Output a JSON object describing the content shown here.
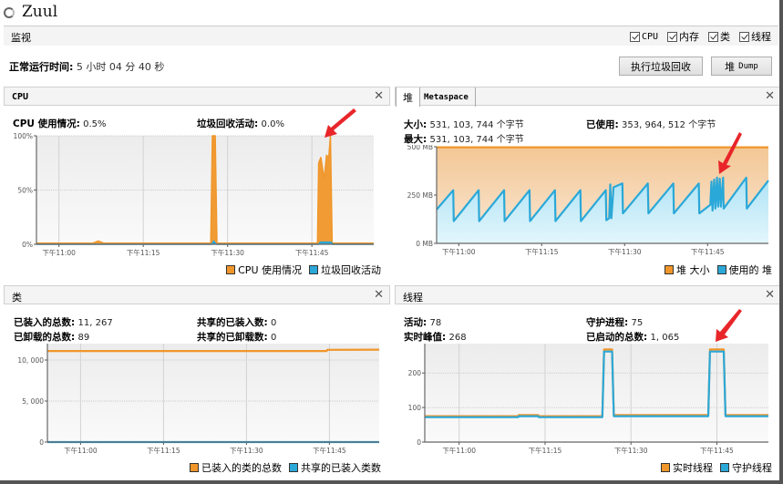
{
  "window": {
    "title": "Zuul"
  },
  "monitor": {
    "label": "监视",
    "checks": [
      {
        "label": "CPU",
        "checked": true
      },
      {
        "label": "内存",
        "checked": true
      },
      {
        "label": "类",
        "checked": true
      },
      {
        "label": "线程",
        "checked": true
      }
    ],
    "uptime_label": "正常运行时间:",
    "uptime_value": "5 小时 04 分 40 秒",
    "gc_button": "执行垃圾回收",
    "dump_button_prefix": "堆",
    "dump_button_suffix": "Dump"
  },
  "colors": {
    "orange": "#f0962a",
    "blue": "#2aa8d8",
    "arrow": "#e8262a"
  },
  "time_ticks": [
    "下午11:00",
    "下午11:15",
    "下午11:30",
    "下午11:45"
  ],
  "cpu": {
    "title": "CPU",
    "usage_label": "CPU 使用情况:",
    "usage_value": "0.5%",
    "gc_label": "垃圾回收活动:",
    "gc_value": "0.0%",
    "legend": [
      "CPU 使用情况",
      "垃圾回收活动"
    ]
  },
  "heap": {
    "tabs": [
      "堆",
      "Metaspace"
    ],
    "size_label": "大小:",
    "size_value": "531, 103, 744 个字节",
    "used_label": "已使用:",
    "used_value": "353, 964, 512 个字节",
    "max_label": "最大:",
    "max_value": "531, 103, 744 个字节",
    "legend": [
      "堆 大小",
      "使用的 堆"
    ]
  },
  "classes": {
    "title": "类",
    "loaded_label": "已装入的总数:",
    "loaded_value": "11, 267",
    "unloaded_label": "已卸载的总数:",
    "unloaded_value": "89",
    "shared_loaded_label": "共享的已装入数:",
    "shared_loaded_value": "0",
    "shared_unloaded_label": "共享的已卸载数:",
    "shared_unloaded_value": "0",
    "legend": [
      "已装入的类的总数",
      "共享的已装入类数"
    ]
  },
  "threads": {
    "title": "线程",
    "live_label": "活动:",
    "live_value": "78",
    "peak_label": "实时峰值:",
    "peak_value": "268",
    "daemon_label": "守护进程:",
    "daemon_value": "75",
    "started_label": "已启动的总数:",
    "started_value": "1, 065",
    "legend": [
      "实时线程",
      "守护线程"
    ]
  },
  "chart_data": [
    {
      "id": "cpu",
      "type": "area",
      "title": "CPU",
      "x_unit": "minutes since 10:56 PM",
      "xlim": [
        0,
        60
      ],
      "x_ticks": [
        4,
        19,
        34,
        49
      ],
      "x_tick_labels": [
        "下午11:00",
        "下午11:15",
        "下午11:30",
        "下午11:45"
      ],
      "ylim": [
        0,
        100
      ],
      "y_ticks": [
        0,
        50,
        100
      ],
      "y_tick_labels": [
        "0%",
        "50%",
        "100%"
      ],
      "series": [
        {
          "name": "CPU 使用情况",
          "color": "#f0962a",
          "points": [
            [
              0,
              1
            ],
            [
              10,
              1
            ],
            [
              11,
              3
            ],
            [
              12,
              1
            ],
            [
              31,
              1
            ],
            [
              31.3,
              100
            ],
            [
              31.8,
              100
            ],
            [
              32.1,
              1
            ],
            [
              50,
              1
            ],
            [
              50.2,
              75
            ],
            [
              50.6,
              80
            ],
            [
              51.2,
              60
            ],
            [
              51.6,
              82
            ],
            [
              52,
              80
            ],
            [
              52.3,
              100
            ],
            [
              52.6,
              1
            ],
            [
              60,
              1
            ]
          ]
        },
        {
          "name": "垃圾回收活动",
          "color": "#2aa8d8",
          "points": [
            [
              0,
              0
            ],
            [
              31.2,
              0
            ],
            [
              31.5,
              3
            ],
            [
              32,
              0
            ],
            [
              50.2,
              0
            ],
            [
              50.5,
              2
            ],
            [
              52.4,
              2
            ],
            [
              52.7,
              0
            ],
            [
              60,
              0
            ]
          ]
        }
      ],
      "legend_position": "bottom-right"
    },
    {
      "id": "heap",
      "type": "area",
      "title": "堆",
      "xlim": [
        0,
        60
      ],
      "x_ticks": [
        4,
        19,
        34,
        49
      ],
      "x_tick_labels": [
        "下午11:00",
        "下午11:15",
        "下午11:30",
        "下午11:45"
      ],
      "ylim": [
        0,
        500
      ],
      "y_ticks": [
        0,
        250,
        500
      ],
      "y_tick_labels": [
        "0 MB",
        "250 MB",
        "500 MB"
      ],
      "series": [
        {
          "name": "堆 大小",
          "color": "#f0962a",
          "points": [
            [
              0,
              497
            ],
            [
              60,
              497
            ]
          ]
        },
        {
          "name": "使用的 堆",
          "color": "#2aa8d8",
          "points": [
            [
              0,
              175
            ],
            [
              3,
              275
            ],
            [
              3.1,
              115
            ],
            [
              7.6,
              275
            ],
            [
              7.7,
              115
            ],
            [
              12.2,
              275
            ],
            [
              12.3,
              115
            ],
            [
              16.8,
              275
            ],
            [
              16.9,
              115
            ],
            [
              21.4,
              275
            ],
            [
              21.5,
              115
            ],
            [
              26,
              275
            ],
            [
              26.1,
              115
            ],
            [
              30.6,
              275
            ],
            [
              30.7,
              120
            ],
            [
              31.2,
              130
            ],
            [
              31.4,
              305
            ],
            [
              31.6,
              130
            ],
            [
              32,
              290
            ],
            [
              33.6,
              310
            ],
            [
              33.7,
              155
            ],
            [
              38.2,
              310
            ],
            [
              38.3,
              155
            ],
            [
              42.8,
              310
            ],
            [
              42.9,
              155
            ],
            [
              47.4,
              310
            ],
            [
              47.5,
              155
            ],
            [
              49.5,
              200
            ],
            [
              49.7,
              320
            ],
            [
              49.9,
              170
            ],
            [
              50.2,
              330
            ],
            [
              50.4,
              180
            ],
            [
              50.7,
              340
            ],
            [
              50.9,
              190
            ],
            [
              51.2,
              335
            ],
            [
              51.4,
              190
            ],
            [
              51.8,
              340
            ],
            [
              51.9,
              180
            ],
            [
              56,
              340
            ],
            [
              56.1,
              180
            ],
            [
              60,
              325
            ]
          ]
        }
      ],
      "legend_position": "bottom-right"
    },
    {
      "id": "classes",
      "type": "line",
      "title": "类",
      "xlim": [
        0,
        60
      ],
      "x_ticks": [
        6,
        21,
        36,
        51
      ],
      "x_tick_labels": [
        "下午11:00",
        "下午11:15",
        "下午11:30",
        "下午11:45"
      ],
      "ylim": [
        0,
        12000
      ],
      "y_ticks": [
        0,
        5000,
        10000
      ],
      "y_tick_labels": [
        "0",
        "5, 000",
        "10, 000"
      ],
      "series": [
        {
          "name": "已装入的类的总数",
          "color": "#f0962a",
          "points": [
            [
              0,
              11100
            ],
            [
              50.5,
              11100
            ],
            [
              50.6,
              11250
            ],
            [
              60,
              11267
            ]
          ]
        },
        {
          "name": "共享的已装入类数",
          "color": "#2aa8d8",
          "points": [
            [
              0,
              0
            ],
            [
              60,
              0
            ]
          ]
        }
      ],
      "legend_position": "bottom-right"
    },
    {
      "id": "threads",
      "type": "line",
      "title": "线程",
      "xlim": [
        0,
        60
      ],
      "x_ticks": [
        6,
        21,
        36,
        51
      ],
      "x_tick_labels": [
        "下午11:00",
        "下午11:15",
        "下午11:30",
        "下午11:45"
      ],
      "ylim": [
        0,
        285
      ],
      "y_ticks": [
        0,
        100,
        200
      ],
      "y_tick_labels": [
        "0",
        "100",
        "200"
      ],
      "series": [
        {
          "name": "实时线程",
          "color": "#f0962a",
          "points": [
            [
              0,
              75
            ],
            [
              16.3,
              75
            ],
            [
              16.4,
              78
            ],
            [
              19.8,
              78
            ],
            [
              19.9,
              75
            ],
            [
              31,
              75
            ],
            [
              31.3,
              268
            ],
            [
              32.7,
              268
            ],
            [
              33,
              78
            ],
            [
              49.5,
              78
            ],
            [
              49.8,
              268
            ],
            [
              52.2,
              268
            ],
            [
              52.5,
              78
            ],
            [
              60,
              78
            ]
          ]
        },
        {
          "name": "守护线程",
          "color": "#2aa8d8",
          "points": [
            [
              0,
              72
            ],
            [
              16.3,
              72
            ],
            [
              16.4,
              75
            ],
            [
              19.8,
              75
            ],
            [
              19.9,
              72
            ],
            [
              31,
              72
            ],
            [
              31.3,
              262
            ],
            [
              32.7,
              262
            ],
            [
              33,
              75
            ],
            [
              49.5,
              75
            ],
            [
              49.8,
              262
            ],
            [
              52.2,
              262
            ],
            [
              52.5,
              75
            ],
            [
              60,
              75
            ]
          ]
        }
      ],
      "legend_position": "bottom-right"
    }
  ]
}
